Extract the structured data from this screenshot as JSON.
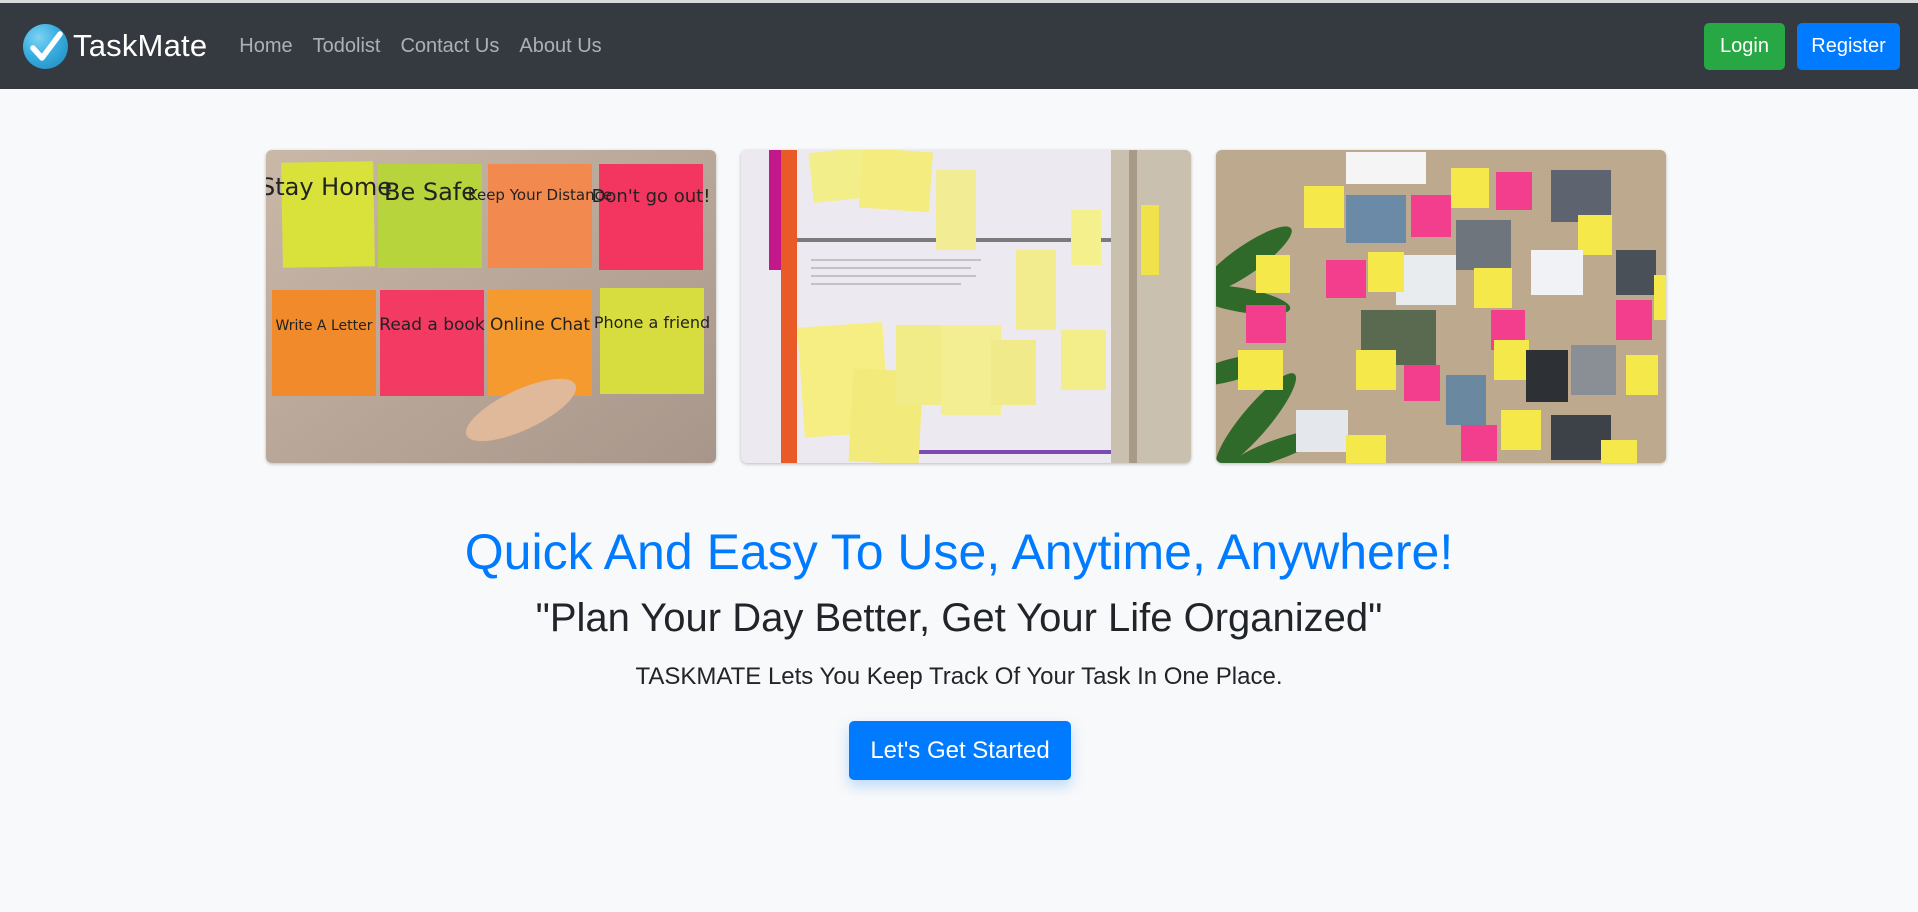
{
  "brand": {
    "name": "TaskMate"
  },
  "nav": {
    "links": [
      "Home",
      "Todolist",
      "Contact Us",
      "About Us"
    ]
  },
  "auth": {
    "login": "Login",
    "register": "Register"
  },
  "images": {
    "sticky_notes": [
      "Stay Home",
      "Be Safe",
      "Keep Your Distance",
      "Don't go out!",
      "Write A Letter",
      "Read a book",
      "Online Chat",
      "Phone a friend"
    ]
  },
  "hero": {
    "headline": "Quick And Easy To Use, Anytime, Anywhere!",
    "subheadline": "\"Plan Your Day Better, Get Your Life Organized\"",
    "description": "TASKMATE Lets You Keep Track Of Your Task In One Place.",
    "cta": "Let's Get Started"
  },
  "colors": {
    "navbar": "#343a40",
    "primary": "#007bff",
    "success": "#28a745",
    "background": "#f8f9fa"
  },
  "icons": {
    "logo": "check-circle-icon"
  }
}
